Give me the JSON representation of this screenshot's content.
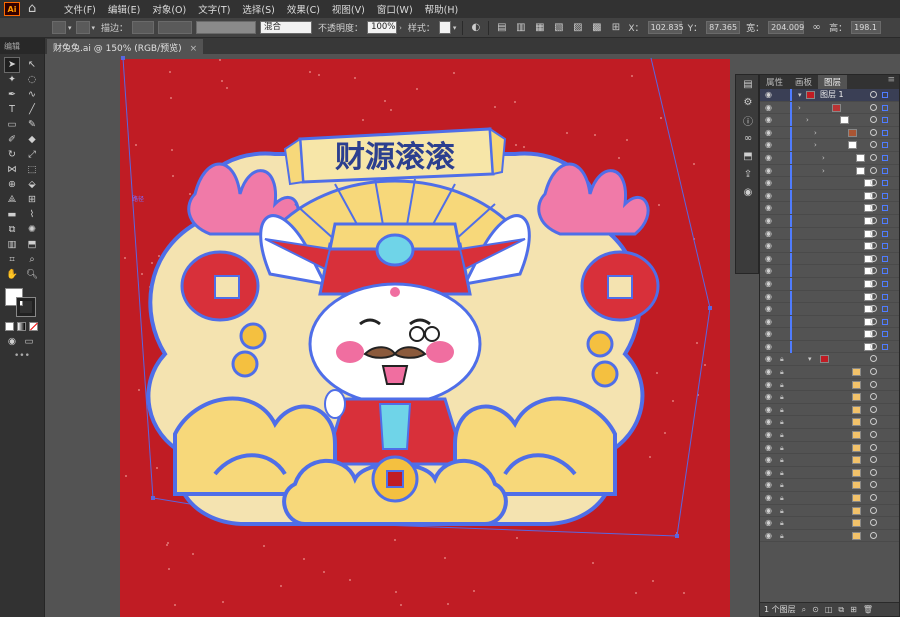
{
  "app": {
    "logo_text": "Ai"
  },
  "menu": [
    "文件(F)",
    "编辑(E)",
    "对象(O)",
    "文字(T)",
    "选择(S)",
    "效果(C)",
    "视图(V)",
    "窗口(W)",
    "帮助(H)"
  ],
  "control_bar": {
    "stroke_label": "描边：",
    "blend_mode": "混合",
    "opacity_label": "不透明度：",
    "opacity_value": "100%",
    "style_label": "样式：",
    "x_label": "X：",
    "x_value": "102.835",
    "y_label": "Y：",
    "y_value": "87.365",
    "w_label": "宽：",
    "w_value": "204.009",
    "h_label": "高：",
    "h_value": "198.1"
  },
  "document_tab": {
    "title": "财兔兔.ai @ 150% (RGB/预览)",
    "close": "×"
  },
  "toolbar": {
    "label": "编辑",
    "more": "•••"
  },
  "canvas": {
    "label_tag": "路径",
    "banner_text": "财源滚滚",
    "colors": {
      "artboard_red": "#c01c24",
      "path_blue": "#4f6ee8",
      "banner_yellow": "#f7d87a",
      "bunny_pink": "#f06ea0"
    }
  },
  "layers_panel": {
    "tabs": [
      "属性",
      "画板",
      "图层"
    ],
    "active_tab": "图层",
    "top_layer_name": "图层 1",
    "footer_count": "1 个图层"
  }
}
